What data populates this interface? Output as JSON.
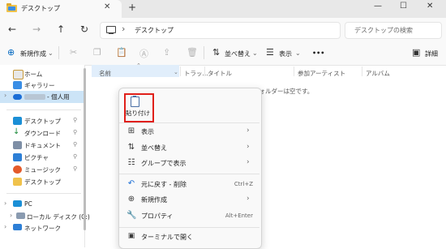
{
  "window": {
    "tab_title": "デスクトップ",
    "tab_close": "✕",
    "new_tab": "+",
    "minimize": "—",
    "maximize": "☐",
    "close": "✕"
  },
  "nav": {
    "back": "←",
    "forward": "→",
    "up": "↑",
    "refresh": "↻",
    "chevron": "›",
    "path": "デスクトップ",
    "search_placeholder": "デスクトップの検索"
  },
  "toolbar": {
    "new_label": "新規作成",
    "new_caret": "⌄",
    "sort_label": "並べ替え",
    "sort_caret": "⌄",
    "view_label": "表示",
    "view_caret": "⌄",
    "more": "•••",
    "details_label": "詳細"
  },
  "sidebar": {
    "home": "ホーム",
    "gallery": "ギャラリー",
    "onedrive_suffix": "- 個人用",
    "desktop": "デスクトップ",
    "downloads": "ダウンロード",
    "documents": "ドキュメント",
    "pictures": "ピクチャ",
    "music": "ミュージック",
    "desktop2": "デスクトップ",
    "pc": "PC",
    "local_disk": "ローカル ディスク (C:)",
    "network": "ネットワーク",
    "pin": "⚲",
    "expand": "›"
  },
  "columns": {
    "name": "名前",
    "track": "トラッ...",
    "title": "タイトル",
    "artist": "参加アーティスト",
    "album": "アルバム"
  },
  "empty_message": "このフォルダーは空です。",
  "context_menu": {
    "paste": "貼り付け",
    "view": "表示",
    "sort": "並べ替え",
    "group": "グループで表示",
    "undo": "元に戻す - 削除",
    "undo_shortcut": "Ctrl+Z",
    "new": "新規作成",
    "properties": "プロパティ",
    "properties_shortcut": "Alt+Enter",
    "terminal": "ターミナルで開く",
    "arrow": "›"
  }
}
